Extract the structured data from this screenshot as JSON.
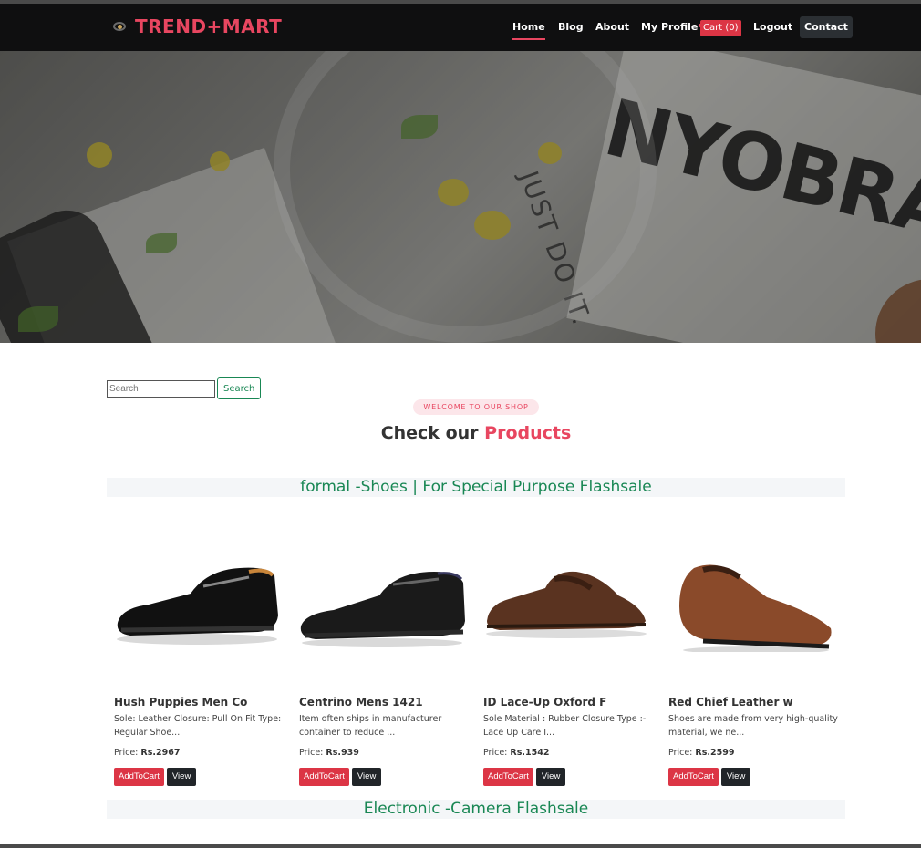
{
  "brand": {
    "name": "TREND+MART"
  },
  "nav": {
    "home": "Home",
    "blog": "Blog",
    "about": "About",
    "profile": "My Profile",
    "cart": "Cart (0)",
    "logout": "Logout",
    "contact": "Contact"
  },
  "hero": {
    "big_text": "NYOBRA",
    "tagline": "JUST DO IT."
  },
  "search": {
    "placeholder": "Search",
    "button": "Search"
  },
  "section": {
    "tag": "WELCOME TO OUR SHOP",
    "title_prefix": "Check our",
    "title_accent": "Products"
  },
  "categories": [
    {
      "title": "formal -Shoes | For Special Purpose Flashsale"
    },
    {
      "title": "Electronic -Camera Flashsale"
    }
  ],
  "products": [
    {
      "name": "Hush Puppies Men Co",
      "desc": "Sole: Leather Closure: Pull On Fit Type: Regular Shoe...",
      "price_label": "Price:",
      "price": "Rs.2967",
      "add_label": "AddToCart",
      "view_label": "View",
      "shoe_color": "#111111"
    },
    {
      "name": "Centrino Mens 1421",
      "desc": "Item often ships in manufacturer container to reduce ...",
      "price_label": "Price:",
      "price": "Rs.939",
      "add_label": "AddToCart",
      "view_label": "View",
      "shoe_color": "#1a1a1a"
    },
    {
      "name": "ID Lace-Up Oxford F",
      "desc": "Sole Material : Rubber Closure Type :- Lace Up Care I...",
      "price_label": "Price:",
      "price": "Rs.1542",
      "add_label": "AddToCart",
      "view_label": "View",
      "shoe_color": "#5a3320"
    },
    {
      "name": "Red Chief Leather w",
      "desc": "Shoes are made from very high-quality material, we ne...",
      "price_label": "Price:",
      "price": "Rs.2599",
      "add_label": "AddToCart",
      "view_label": "View",
      "shoe_color": "#8a4a2a"
    }
  ],
  "colors": {
    "accent": "#e84660",
    "success": "#198754",
    "nav_bg": "#0f0f10",
    "danger": "#dc3545",
    "dark": "#212529"
  }
}
